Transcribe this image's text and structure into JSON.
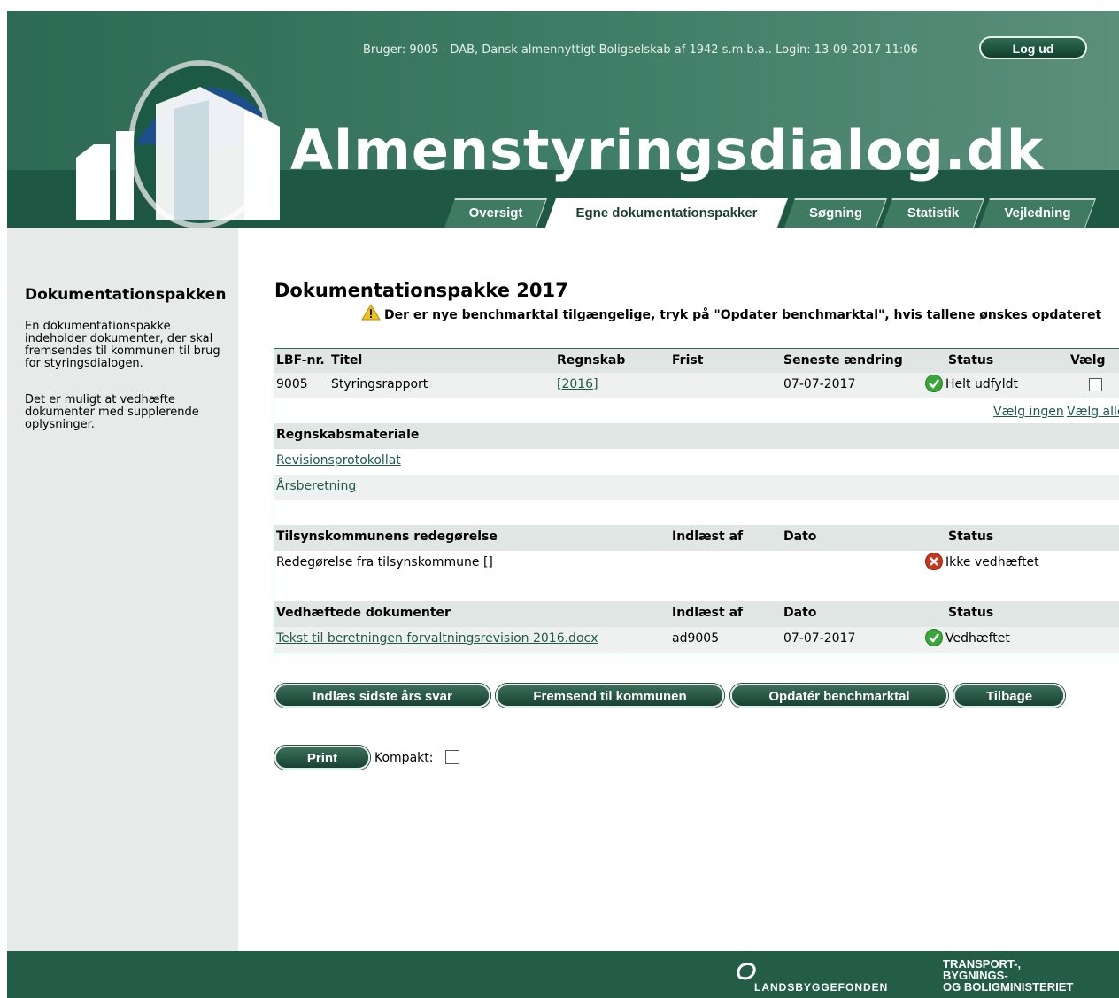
{
  "header": {
    "user_line": "Bruger: 9005 - DAB, Dansk almennyttigt Boligselskab af 1942 s.m.b.a.. Login: 13-09-2017 11:06",
    "logout_label": "Log ud",
    "site_title": "Almenstyringsdialog.dk"
  },
  "tabs": [
    {
      "label": "Oversigt",
      "active": false
    },
    {
      "label": "Egne dokumentationspakker",
      "active": true
    },
    {
      "label": "Søgning",
      "active": false
    },
    {
      "label": "Statistik",
      "active": false
    },
    {
      "label": "Vejledning",
      "active": false
    }
  ],
  "sidebar": {
    "title": "Dokumentationspakken",
    "paragraph1": "En dokumentationspakke indeholder dokumenter, der skal fremsendes til kommunen til brug for styringsdialogen.",
    "paragraph2": "Det er muligt at vedhæfte dokumenter med supplerende oplysninger."
  },
  "main": {
    "title": "Dokumentationspakke 2017",
    "warning": "Der er nye benchmarktal tilgængelige, tryk på \"Opdater benchmarktal\", hvis tallene ønskes opdateret",
    "report_table": {
      "headers": [
        "LBF-nr.",
        "Titel",
        "Regnskab",
        "Frist",
        "Seneste ændring",
        "Status",
        "Vælg"
      ],
      "row": {
        "lbf": "9005",
        "titel": "Styringsrapport",
        "regnskab": "[2016]",
        "frist": "",
        "seneste": "07-07-2017",
        "status": "Helt udfyldt"
      },
      "select_none": "Vælg ingen",
      "select_all": "Vælg alle"
    },
    "regnskab_section": {
      "heading": "Regnskabsmateriale",
      "links": [
        "Revisionsprotokollat",
        "Årsberetning"
      ]
    },
    "tilsyn_section": {
      "headers": [
        "Tilsynskommunens redegørelse",
        "Indlæst af",
        "Dato",
        "Status"
      ],
      "row": {
        "title": "Redegørelse fra tilsynskommune []",
        "indlaest": "",
        "dato": "",
        "status": "Ikke vedhæftet"
      }
    },
    "attached_section": {
      "headers": [
        "Vedhæftede dokumenter",
        "Indlæst af",
        "Dato",
        "Status"
      ],
      "row": {
        "title": "Tekst til beretningen forvaltningsrevision 2016.docx",
        "indlaest": "ad9005",
        "dato": "07-07-2017",
        "status": "Vedhæftet"
      }
    },
    "buttons": {
      "load_last_year": "Indlæs sidste års svar",
      "send_to_municipality": "Fremsend til kommunen",
      "update_benchmark": "Opdatér benchmarktal",
      "back": "Tilbage",
      "print": "Print"
    },
    "compact_label": "Kompakt:"
  },
  "footer": {
    "lbf": "LANDSBYGGEFONDEN",
    "ministry_line1": "TRANSPORT-,",
    "ministry_line2": "BYGNINGS-",
    "ministry_line3": "OG BOLIGMINISTERIET"
  },
  "colors": {
    "header_green": "#2d6a55",
    "footer_green": "#235d47",
    "link": "#1f5a4a",
    "ok": "#39a63a",
    "error": "#c8361f"
  }
}
